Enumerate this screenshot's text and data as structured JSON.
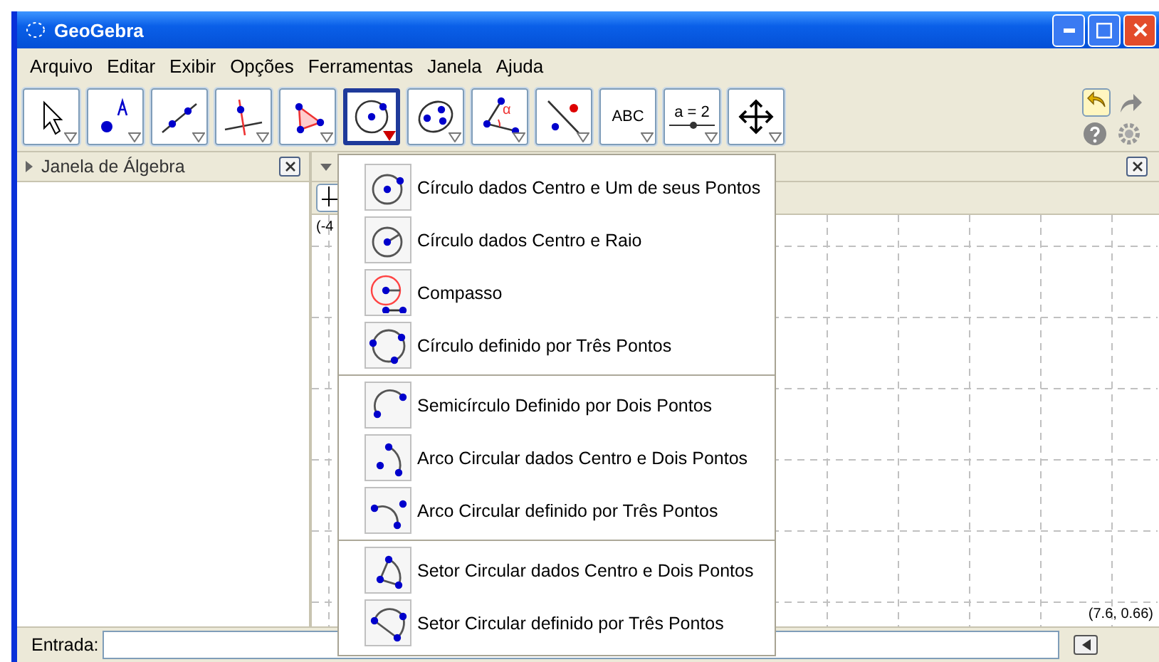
{
  "window": {
    "title": "GeoGebra"
  },
  "menu": [
    "Arquivo",
    "Editar",
    "Exibir",
    "Opções",
    "Ferramentas",
    "Janela",
    "Ajuda"
  ],
  "toolbar": {
    "tools": [
      {
        "kind": "move",
        "selected": false
      },
      {
        "kind": "point",
        "selected": false
      },
      {
        "kind": "line",
        "selected": false
      },
      {
        "kind": "perpendicular",
        "selected": false
      },
      {
        "kind": "polygon",
        "selected": false
      },
      {
        "kind": "circle",
        "selected": true
      },
      {
        "kind": "ellipse",
        "selected": false
      },
      {
        "kind": "angle",
        "label": "α",
        "selected": false
      },
      {
        "kind": "reflect",
        "selected": false
      },
      {
        "kind": "text",
        "label": "ABC",
        "selected": false
      },
      {
        "kind": "slider",
        "label": "a = 2",
        "selected": false
      },
      {
        "kind": "pan",
        "selected": false
      }
    ]
  },
  "algebra_panel": {
    "title": "Janela de Álgebra"
  },
  "graphics_panel": {
    "corner_label": "(-4",
    "coordinates": "(7.6, 0.66)"
  },
  "dropdown": {
    "sections": [
      {
        "items": [
          {
            "kind": "center-point",
            "label": "Círculo dados Centro e Um de seus Pontos"
          },
          {
            "kind": "center-radius",
            "label": "Círculo dados Centro e Raio"
          },
          {
            "kind": "compass",
            "label": "Compasso"
          },
          {
            "kind": "three-points",
            "label": "Círculo definido por Três Pontos"
          }
        ]
      },
      {
        "items": [
          {
            "kind": "semicircle",
            "label": "Semicírculo Definido por Dois Pontos"
          },
          {
            "kind": "arc-center",
            "label": "Arco Circular dados Centro e Dois Pontos"
          },
          {
            "kind": "arc-three",
            "label": "Arco Circular definido por Três Pontos"
          }
        ]
      },
      {
        "items": [
          {
            "kind": "sector-center",
            "label": "Setor Circular dados Centro e Dois Pontos"
          },
          {
            "kind": "sector-three",
            "label": "Setor Circular definido por Três Pontos"
          }
        ]
      }
    ]
  },
  "input_bar": {
    "label": "Entrada:"
  }
}
